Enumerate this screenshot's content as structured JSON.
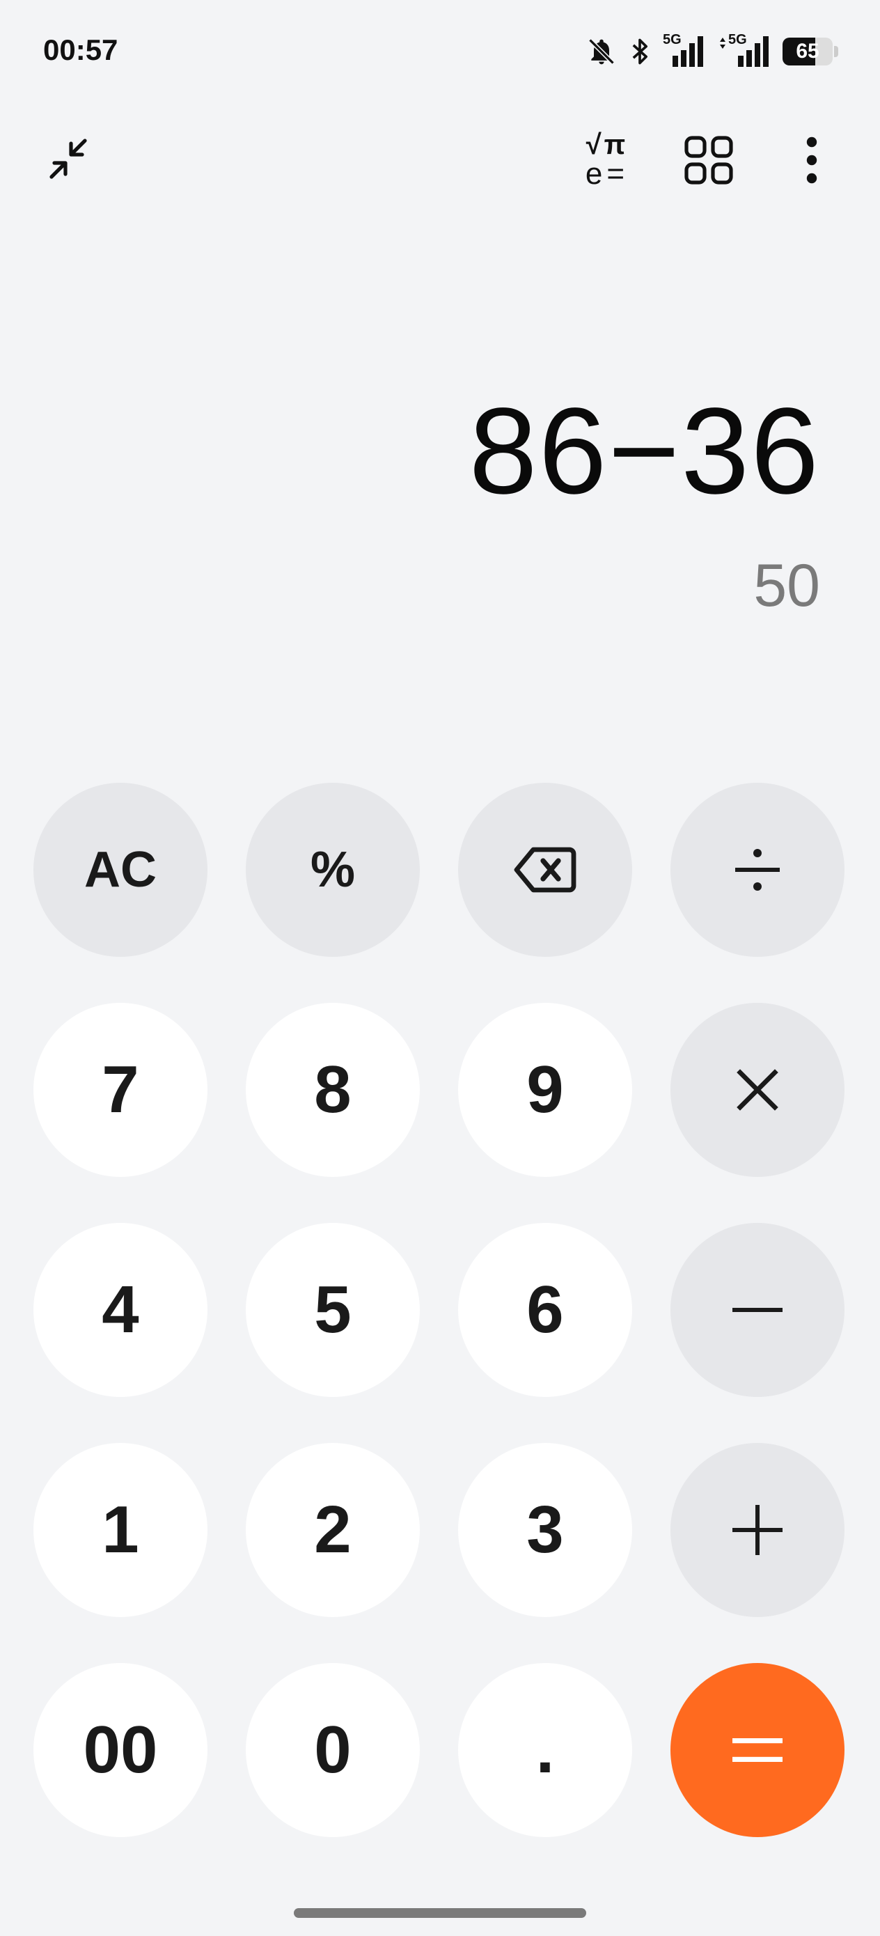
{
  "status_bar": {
    "time": "00:57",
    "signal_label_1": "5G",
    "signal_label_2": "5G",
    "battery_level": "65",
    "icons": [
      "bell-off-icon",
      "bluetooth-icon",
      "signal-5g-icon",
      "signal-5g-data-icon",
      "battery-icon"
    ]
  },
  "toolbar": {
    "icons": [
      "collapse-icon",
      "scientific-mode-icon",
      "grid-apps-icon",
      "more-vertical-icon"
    ],
    "scientific_top": "√π",
    "scientific_bottom": "e="
  },
  "display": {
    "expression": "86−36",
    "result": "50"
  },
  "keypad": {
    "row1": [
      "AC",
      "%",
      "⌫",
      "÷"
    ],
    "row2": [
      "7",
      "8",
      "9",
      "×"
    ],
    "row3": [
      "4",
      "5",
      "6",
      "−"
    ],
    "row4": [
      "1",
      "2",
      "3",
      "+"
    ],
    "row5": [
      "00",
      "0",
      ".",
      "="
    ]
  },
  "colors": {
    "background": "#F3F4F6",
    "digit_key": "#FFFFFF",
    "function_key": "#E6E7EA",
    "equals_key": "#FF6A1F",
    "result_text": "#7A7A7A"
  }
}
